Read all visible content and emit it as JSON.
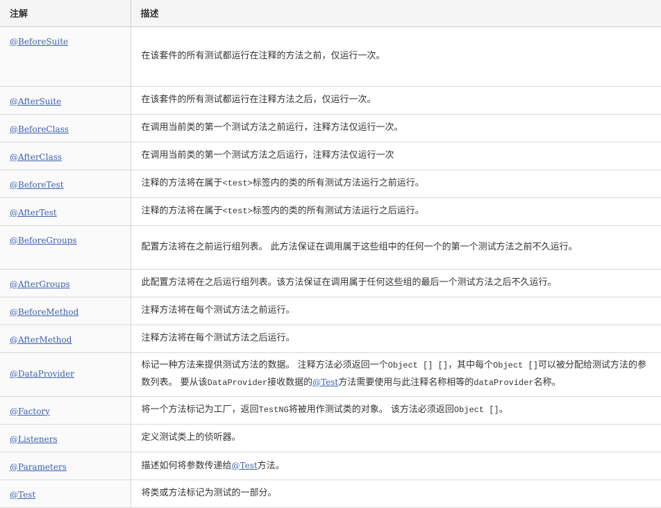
{
  "header": {
    "col1": "注解",
    "col2": "描述"
  },
  "rows": [
    {
      "annotation": "@BeforeSuite",
      "description": "在该套件的所有测试都运行在注释的方法之前，仅运行一次。"
    },
    {
      "annotation": "@AfterSuite",
      "description": "在该套件的所有测试都运行在注释方法之后，仅运行一次。"
    },
    {
      "annotation": "@BeforeClass",
      "description": "在调用当前类的第一个测试方法之前运行，注释方法仅运行一次。"
    },
    {
      "annotation": "@AfterClass",
      "description": "在调用当前类的第一个测试方法之后运行，注释方法仅运行一次"
    },
    {
      "annotation": "@BeforeTest",
      "desc_a": "注释的方法将在属于",
      "desc_code": "<test>",
      "desc_b": "标签内的类的所有测试方法运行之前运行。"
    },
    {
      "annotation": "@AfterTest",
      "desc_a": "注释的方法将在属于",
      "desc_code": "<test>",
      "desc_b": "标签内的类的所有测试方法运行之后运行。"
    },
    {
      "annotation": "@BeforeGroups",
      "description": "配置方法将在之前运行组列表。 此方法保证在调用属于这些组中的任何一个的第一个测试方法之前不久运行。"
    },
    {
      "annotation": "@AfterGroups",
      "description": "此配置方法将在之后运行组列表。该方法保证在调用属于任何这些组的最后一个测试方法之后不久运行。"
    },
    {
      "annotation": "@BeforeMethod",
      "description": "注释方法将在每个测试方法之前运行。"
    },
    {
      "annotation": "@AfterMethod",
      "description": "注释方法将在每个测试方法之后运行。"
    },
    {
      "annotation": "@DataProvider",
      "d1": "标记一种方法来提供测试方法的数据。 注释方法必须返回一个",
      "c1": "Object [] []",
      "d2": "，其中每个",
      "c2": "Object []",
      "d3": "可以被分配给测试方法的参数列表。 要从该",
      "c3": "DataProvider",
      "d4": "接收数据的",
      "link": "@Test",
      "d5": "方法需要使用与此注释名称相等的",
      "c4": "dataProvider",
      "d6": "名称。"
    },
    {
      "annotation": "@Factory",
      "d1": "将一个方法标记为工厂，返回",
      "c1": "TestNG",
      "d2": "将被用作测试类的对象。 该方法必须返回",
      "c2": "Object []",
      "d3": "。"
    },
    {
      "annotation": "@Listeners",
      "description": "定义测试类上的侦听器。"
    },
    {
      "annotation": "@Parameters",
      "d1": "描述如何将参数传递给",
      "link": "@Test",
      "d2": "方法。"
    },
    {
      "annotation": "@Test",
      "description": "将类或方法标记为测试的一部分。"
    }
  ]
}
